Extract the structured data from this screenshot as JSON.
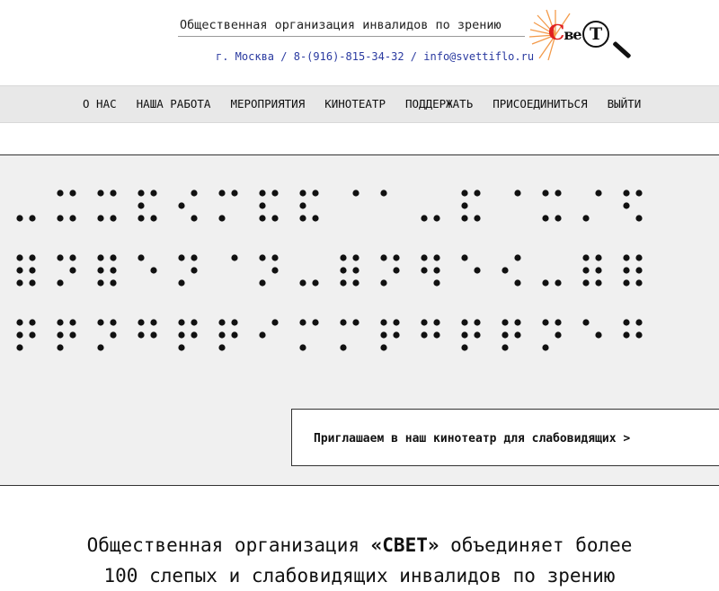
{
  "header": {
    "org_name": "Общественная организация инвалидов по зрению",
    "contacts": {
      "city": "г. Москва",
      "separator": "/",
      "phone": "8-(916)-815-34-32",
      "email": "info@svettiflo.ru"
    },
    "logo": {
      "text_big_c": "С",
      "text_small": "ве",
      "text_t": "Т",
      "alt": "Свет"
    }
  },
  "nav": {
    "items": [
      {
        "label": "О НАС"
      },
      {
        "label": "НАША РАБОТА"
      },
      {
        "label": "МЕРОПРИЯТИЯ"
      },
      {
        "label": "КИНОТЕАТР"
      },
      {
        "label": "ПОДДЕРЖАТЬ"
      },
      {
        "label": "ПРИСОЕДИНИТЬСЯ"
      },
      {
        "label": "ВЫЙТИ"
      }
    ]
  },
  "hero": {
    "cta_label": "Приглашаем в наш кинотеатр для слабовидящих >"
  },
  "intro": {
    "line1_before": "Общественная организация ",
    "line1_brand": "«СВЕТ»",
    "line1_after": " объединяет более",
    "line2": "100 слепых и слабовидящих инвалидов по зрению"
  },
  "colors": {
    "accent": "#e02020",
    "link": "#2a3aa0",
    "nav_bg": "#e8e8e8",
    "hero_bg": "#f0f0f0"
  }
}
